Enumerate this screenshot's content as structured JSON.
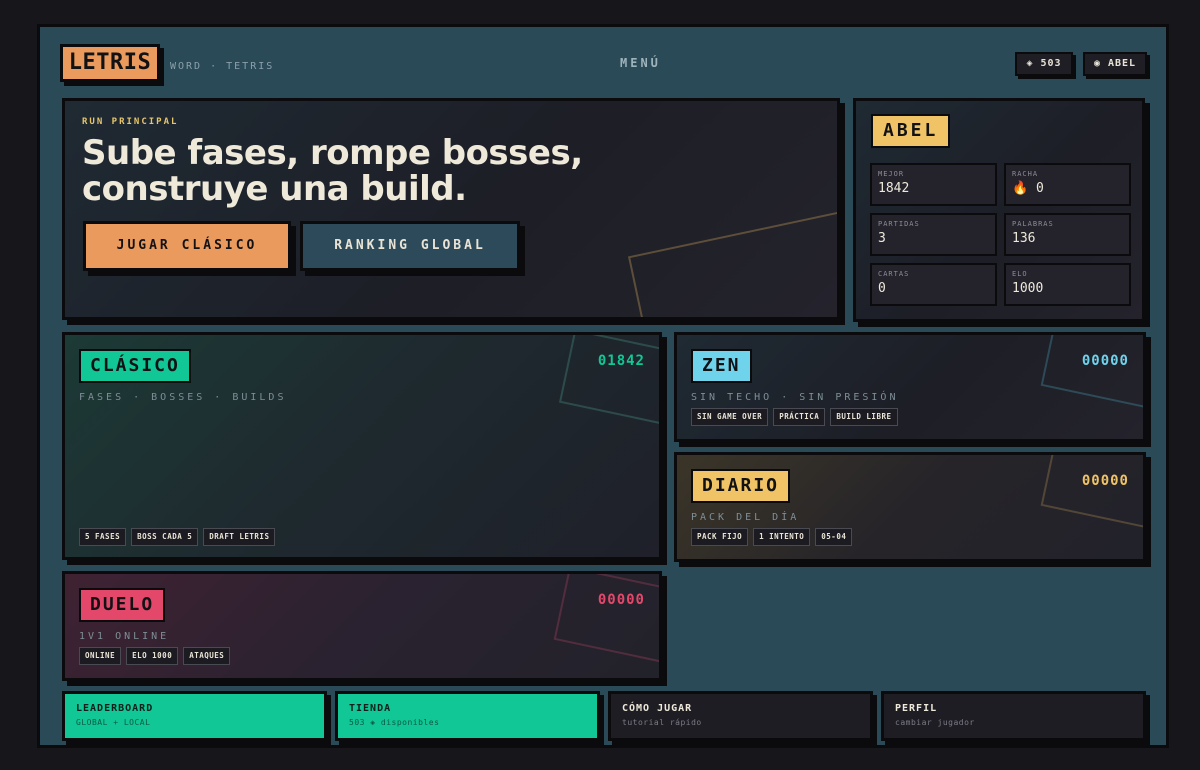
{
  "header": {
    "logo": "LETRIS",
    "logo_sub": "WORD · TETRIS",
    "menu": "MENÚ",
    "coins": "◈ 503",
    "user": "◉ ABEL"
  },
  "hero": {
    "kicker": "RUN PRINCIPAL",
    "headline": "Sube fases, rompe bosses, construye una build.",
    "primary_button": "JUGAR CLÁSICO",
    "secondary_button": "RANKING GLOBAL"
  },
  "player": {
    "name": "ABEL",
    "stats": [
      {
        "label": "MEJOR",
        "value": "1842"
      },
      {
        "label": "RACHA",
        "value": "🔥 0"
      },
      {
        "label": "PARTIDAS",
        "value": "3"
      },
      {
        "label": "PALABRAS",
        "value": "136"
      },
      {
        "label": "CARTAS",
        "value": "0"
      },
      {
        "label": "ELO",
        "value": "1000"
      }
    ]
  },
  "modes": {
    "clasico": {
      "title": "CLÁSICO",
      "score": "01842",
      "subtitle": "FASES · BOSSES · BUILDS",
      "tags": [
        "5 FASES",
        "BOSS CADA 5",
        "DRAFT LETRIS"
      ],
      "color": "#10c795"
    },
    "zen": {
      "title": "ZEN",
      "score": "00000",
      "subtitle": "SIN TECHO · SIN PRESIÓN",
      "tags": [
        "SIN GAME OVER",
        "PRÁCTICA",
        "BUILD LIBRE"
      ],
      "color": "#6fd3ec"
    },
    "diario": {
      "title": "DIARIO",
      "score": "00000",
      "subtitle": "PACK DEL DÍA",
      "tags": [
        "PACK FIJO",
        "1 INTENTO",
        "05-04"
      ],
      "color": "#f0c466"
    },
    "duelo": {
      "title": "DUELO",
      "score": "00000",
      "subtitle": "1V1 ONLINE",
      "tags": [
        "ONLINE",
        "ELO 1000",
        "ATAQUES"
      ],
      "color": "#e3486b"
    }
  },
  "tiles": [
    {
      "title": "LEADERBOARD",
      "subtitle": "GLOBAL + LOCAL"
    },
    {
      "title": "TIENDA",
      "subtitle": "503 ◈ disponibles"
    },
    {
      "title": "CÓMO JUGAR",
      "subtitle": "tutorial rápido"
    },
    {
      "title": "PERFIL",
      "subtitle": "cambiar jugador"
    }
  ]
}
